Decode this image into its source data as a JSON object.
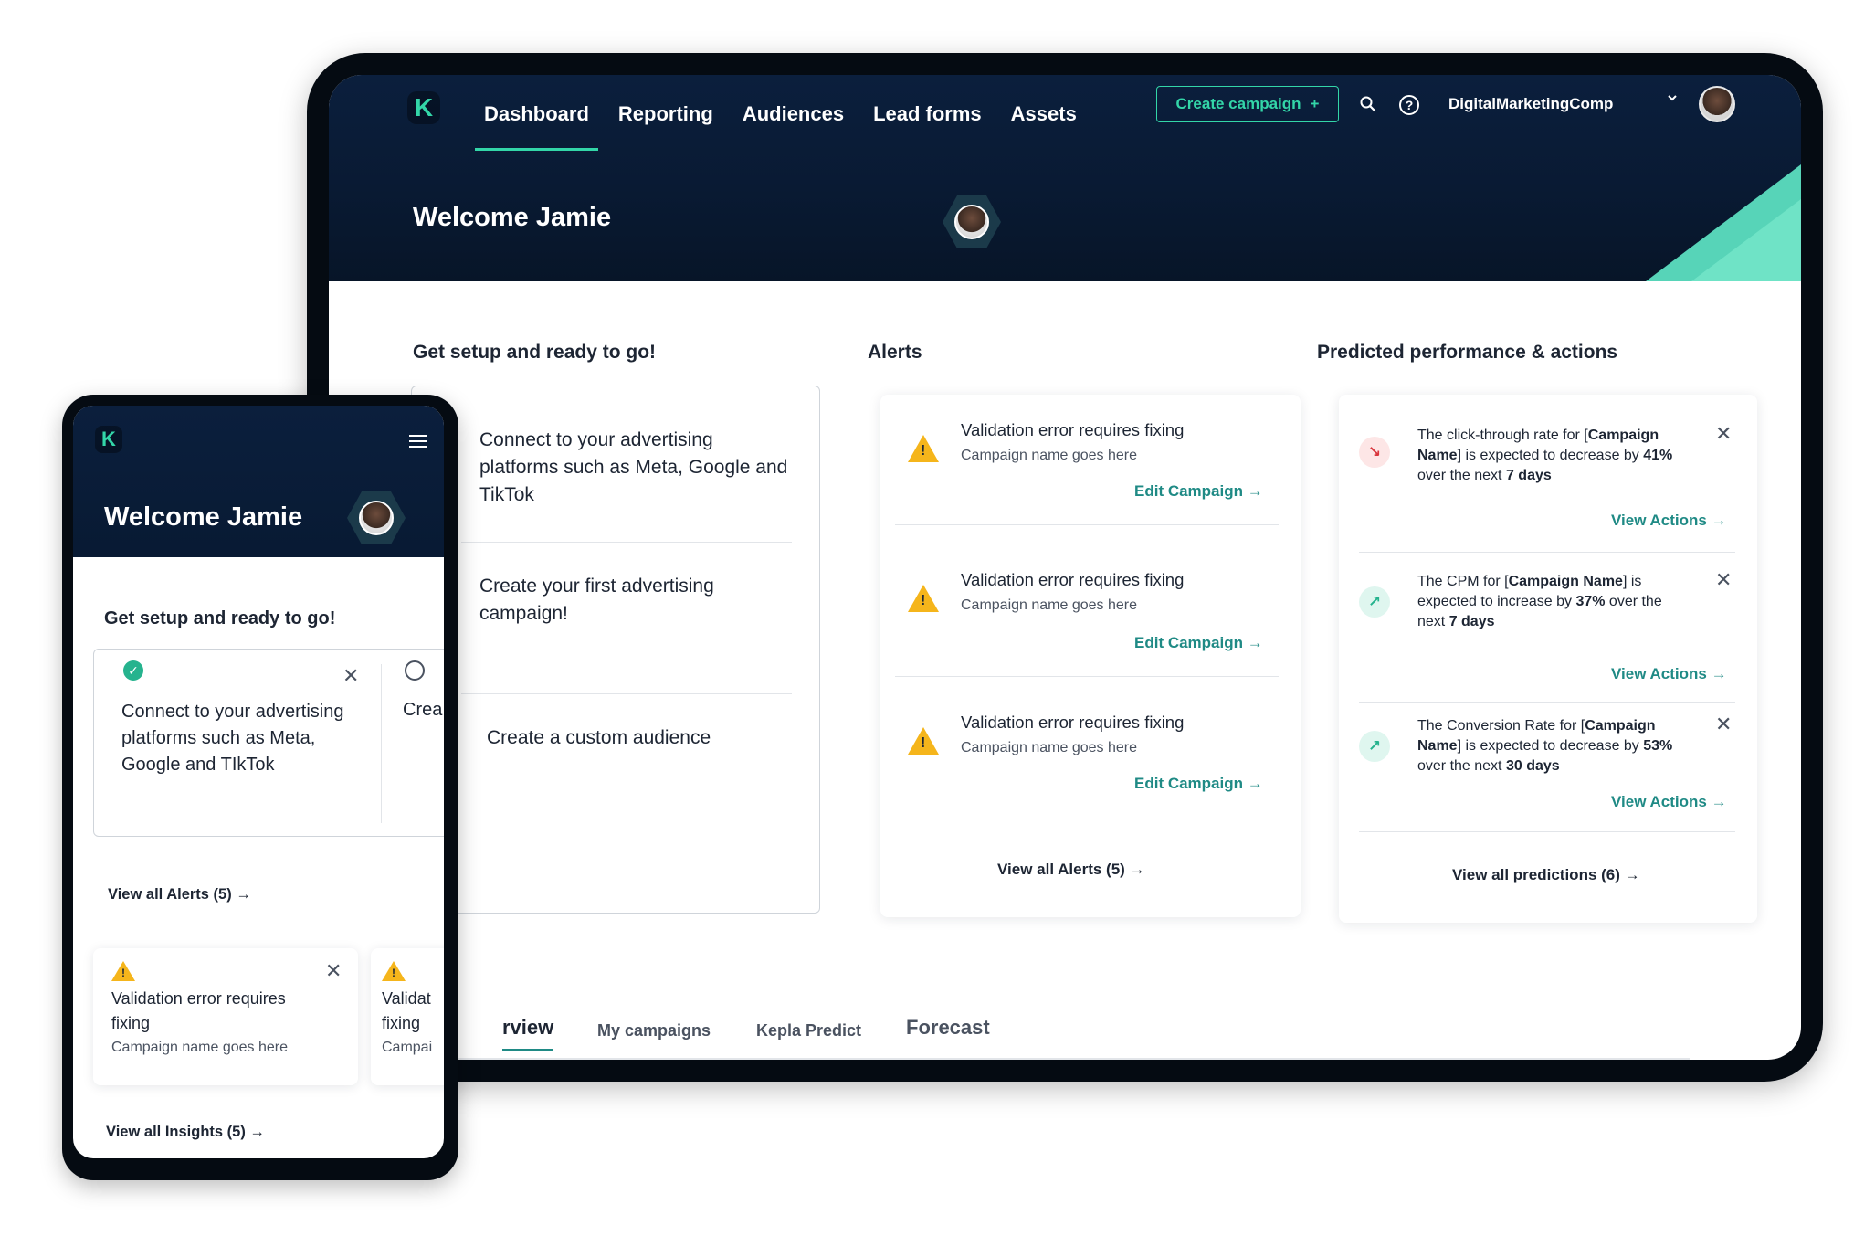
{
  "tablet": {
    "nav": {
      "logo": "K",
      "items": [
        "Dashboard",
        "Reporting",
        "Audiences",
        "Lead forms",
        "Assets"
      ],
      "create_button": "Create campaign",
      "create_plus": "+",
      "account_name": "DigitalMarketingComp"
    },
    "welcome": "Welcome Jamie",
    "setup": {
      "title": "Get setup and ready to go!",
      "items": [
        "Connect to your advertising platforms such as Meta, Google and TikTok",
        "Create your first advertising campaign!",
        "Create a custom audience"
      ]
    },
    "alerts": {
      "title": "Alerts",
      "items": [
        {
          "title": "Validation error requires fixing",
          "subtitle": "Campaign name goes here",
          "link": "Edit Campaign"
        },
        {
          "title": "Validation error requires fixing",
          "subtitle": "Campaign name goes here",
          "link": "Edit Campaign"
        },
        {
          "title": "Validation error requires fixing",
          "subtitle": "Campaign name goes here",
          "link": "Edit Campaign"
        }
      ],
      "view_all": "View all Alerts (5)"
    },
    "predictions": {
      "title": "Predicted performance & actions",
      "items": [
        {
          "pre": "The click-through rate for [",
          "name": "Campaign Name",
          "mid": "]  is expected to decrease by ",
          "pct": "41%",
          "post": " over the next ",
          "days": "7 days",
          "link": "View Actions",
          "trend": "down"
        },
        {
          "pre": "The CPM for [",
          "name": "Campaign Name",
          "mid": "]  is expected to increase by ",
          "pct": "37%",
          "post": " over the next ",
          "days": "7 days",
          "link": "View Actions",
          "trend": "up"
        },
        {
          "pre": "The Conversion Rate for [",
          "name": "Campaign Name",
          "mid": "]  is expected to decrease by ",
          "pct": "53%",
          "post": " over the next ",
          "days": "30 days",
          "link": "View Actions",
          "trend": "up"
        }
      ],
      "view_all": "View all predictions (6)"
    },
    "tabs": [
      "rview",
      "My campaigns",
      "Kepla Predict",
      "Forecast"
    ]
  },
  "phone": {
    "logo": "K",
    "welcome": "Welcome Jamie",
    "setup": {
      "title": "Get setup and ready to go!",
      "item1": "Connect to your advertising platforms such as Meta, Google and TIkTok",
      "item2": "Crea adve"
    },
    "view_all_alerts": "View all Alerts (5)",
    "alerts": [
      {
        "title": "Validation error requires fixing",
        "subtitle": "Campaign name goes here"
      },
      {
        "title": "Validat fixing",
        "subtitle": "Campai"
      }
    ],
    "view_all_insights": "View all Insights (5)"
  },
  "colors": {
    "navy": "#0b1f3d",
    "accent": "#33d6a8",
    "link": "#1f8a85",
    "warning": "#f5b51b",
    "negative": "#d9363e",
    "positive": "#26b38e"
  },
  "icons": [
    "search-icon",
    "help-icon",
    "chevron-down-icon",
    "warning-icon",
    "close-icon",
    "arrow-right-icon",
    "trend-down-icon",
    "trend-up-icon",
    "menu-icon",
    "check-circle-icon",
    "empty-circle-icon"
  ]
}
